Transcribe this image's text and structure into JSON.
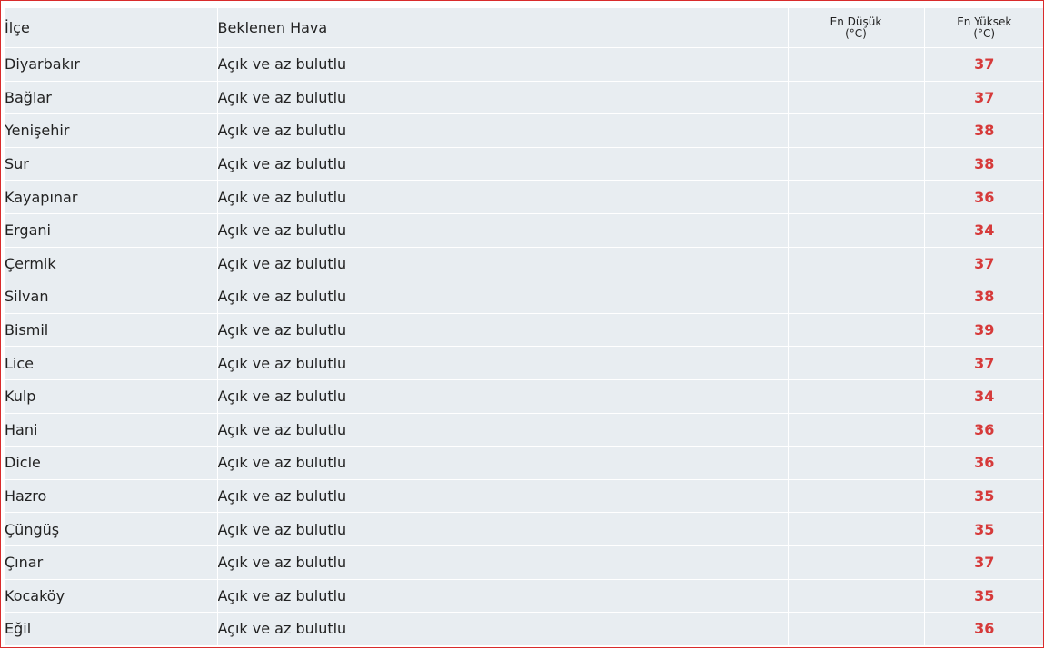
{
  "table": {
    "headers": {
      "district": "İlçe",
      "expected_weather": "Beklenen Hava",
      "min_line1": "En Düşük",
      "min_line2": "(°C)",
      "max_line1": "En Yüksek",
      "max_line2": "(°C)"
    },
    "accent_color": "#d63a3a",
    "rows": [
      {
        "district": "Diyarbakır",
        "weather": "Açık ve az bulutlu",
        "min": "",
        "max": "37"
      },
      {
        "district": "Bağlar",
        "weather": "Açık ve az bulutlu",
        "min": "",
        "max": "37"
      },
      {
        "district": "Yenişehir",
        "weather": "Açık ve az bulutlu",
        "min": "",
        "max": "38"
      },
      {
        "district": "Sur",
        "weather": "Açık ve az bulutlu",
        "min": "",
        "max": "38"
      },
      {
        "district": "Kayapınar",
        "weather": "Açık ve az bulutlu",
        "min": "",
        "max": "36"
      },
      {
        "district": "Ergani",
        "weather": "Açık ve az bulutlu",
        "min": "",
        "max": "34"
      },
      {
        "district": "Çermik",
        "weather": "Açık ve az bulutlu",
        "min": "",
        "max": "37"
      },
      {
        "district": "Silvan",
        "weather": "Açık ve az bulutlu",
        "min": "",
        "max": "38"
      },
      {
        "district": "Bismil",
        "weather": "Açık ve az bulutlu",
        "min": "",
        "max": "39"
      },
      {
        "district": "Lice",
        "weather": "Açık ve az bulutlu",
        "min": "",
        "max": "37"
      },
      {
        "district": "Kulp",
        "weather": "Açık ve az bulutlu",
        "min": "",
        "max": "34"
      },
      {
        "district": "Hani",
        "weather": "Açık ve az bulutlu",
        "min": "",
        "max": "36"
      },
      {
        "district": "Dicle",
        "weather": "Açık ve az bulutlu",
        "min": "",
        "max": "36"
      },
      {
        "district": "Hazro",
        "weather": "Açık ve az bulutlu",
        "min": "",
        "max": "35"
      },
      {
        "district": "Çüngüş",
        "weather": "Açık ve az bulutlu",
        "min": "",
        "max": "35"
      },
      {
        "district": "Çınar",
        "weather": "Açık ve az bulutlu",
        "min": "",
        "max": "37"
      },
      {
        "district": "Kocaköy",
        "weather": "Açık ve az bulutlu",
        "min": "",
        "max": "35"
      },
      {
        "district": "Eğil",
        "weather": "Açık ve az bulutlu",
        "min": "",
        "max": "36"
      }
    ]
  }
}
